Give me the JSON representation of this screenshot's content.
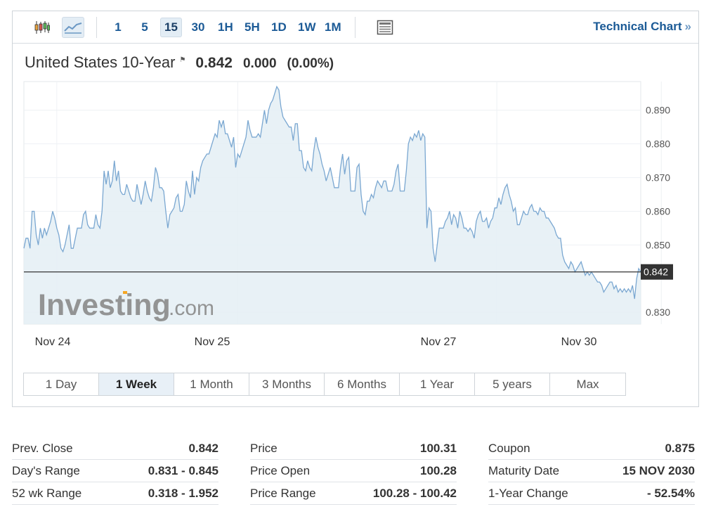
{
  "toolbar": {
    "timeframes": [
      "1",
      "5",
      "15",
      "30",
      "1H",
      "5H",
      "1D",
      "1W",
      "1M"
    ],
    "active_timeframe": "15",
    "technical_chart_label": "Technical Chart",
    "technical_chart_arrow": "»"
  },
  "quote": {
    "name": "United States 10-Year",
    "price": "0.842",
    "change": "0.000",
    "change_pct": "(0.00%)"
  },
  "chart_data": {
    "type": "area",
    "title": "",
    "xlabel": "",
    "ylabel": "",
    "x_tick_labels": [
      "Nov 24",
      "Nov 25",
      "Nov 27",
      "Nov 30"
    ],
    "y_tick_labels": [
      "0.890",
      "0.880",
      "0.870",
      "0.860",
      "0.850",
      "0.830"
    ],
    "ylim": [
      0.8265,
      0.8985
    ],
    "last_value_label": "0.842",
    "last_value": 0.842,
    "watermark": "Investing.com",
    "colors": {
      "line": "#7aa7d1",
      "fill": "#e4eef4",
      "reference": "#333333",
      "badge": "#333333"
    },
    "series": [
      {
        "values": [
          0.849,
          0.852,
          0.852,
          0.849,
          0.86,
          0.86,
          0.853,
          0.85,
          0.855,
          0.852,
          0.855,
          0.853,
          0.855,
          0.857,
          0.86,
          0.858,
          0.855,
          0.853,
          0.849,
          0.848,
          0.85,
          0.853,
          0.856,
          0.849,
          0.849,
          0.852,
          0.855,
          0.855,
          0.855,
          0.859,
          0.86,
          0.856,
          0.855,
          0.855,
          0.855,
          0.859,
          0.856,
          0.855,
          0.86,
          0.872,
          0.868,
          0.872,
          0.867,
          0.869,
          0.875,
          0.869,
          0.872,
          0.866,
          0.865,
          0.865,
          0.868,
          0.866,
          0.864,
          0.863,
          0.863,
          0.868,
          0.865,
          0.862,
          0.865,
          0.869,
          0.866,
          0.864,
          0.863,
          0.867,
          0.873,
          0.871,
          0.867,
          0.867,
          0.866,
          0.86,
          0.855,
          0.859,
          0.86,
          0.861,
          0.864,
          0.865,
          0.86,
          0.86,
          0.862,
          0.869,
          0.866,
          0.864,
          0.872,
          0.865,
          0.87,
          0.869,
          0.873,
          0.875,
          0.876,
          0.877,
          0.877,
          0.879,
          0.881,
          0.883,
          0.882,
          0.887,
          0.885,
          0.887,
          0.883,
          0.883,
          0.881,
          0.879,
          0.882,
          0.873,
          0.877,
          0.876,
          0.878,
          0.88,
          0.882,
          0.887,
          0.884,
          0.882,
          0.882,
          0.882,
          0.883,
          0.882,
          0.886,
          0.89,
          0.886,
          0.89,
          0.892,
          0.893,
          0.895,
          0.897,
          0.896,
          0.891,
          0.888,
          0.887,
          0.886,
          0.885,
          0.885,
          0.881,
          0.886,
          0.886,
          0.878,
          0.878,
          0.873,
          0.872,
          0.875,
          0.873,
          0.872,
          0.878,
          0.882,
          0.879,
          0.877,
          0.874,
          0.872,
          0.869,
          0.871,
          0.873,
          0.87,
          0.867,
          0.867,
          0.867,
          0.873,
          0.877,
          0.871,
          0.875,
          0.876,
          0.866,
          0.866,
          0.866,
          0.873,
          0.874,
          0.865,
          0.86,
          0.859,
          0.863,
          0.863,
          0.865,
          0.864,
          0.867,
          0.869,
          0.868,
          0.867,
          0.869,
          0.869,
          0.866,
          0.866,
          0.866,
          0.868,
          0.872,
          0.874,
          0.866,
          0.866,
          0.866,
          0.872,
          0.88,
          0.882,
          0.881,
          0.883,
          0.882,
          0.884,
          0.881,
          0.883,
          0.882,
          0.855,
          0.861,
          0.86,
          0.849,
          0.845,
          0.85,
          0.855,
          0.855,
          0.855,
          0.857,
          0.858,
          0.86,
          0.856,
          0.859,
          0.858,
          0.855,
          0.86,
          0.858,
          0.855,
          0.855,
          0.854,
          0.855,
          0.854,
          0.852,
          0.857,
          0.859,
          0.86,
          0.857,
          0.857,
          0.858,
          0.855,
          0.857,
          0.858,
          0.861,
          0.861,
          0.864,
          0.862,
          0.865,
          0.867,
          0.868,
          0.865,
          0.863,
          0.86,
          0.861,
          0.856,
          0.856,
          0.858,
          0.86,
          0.859,
          0.859,
          0.861,
          0.862,
          0.86,
          0.86,
          0.859,
          0.861,
          0.86,
          0.86,
          0.858,
          0.858,
          0.857,
          0.856,
          0.855,
          0.853,
          0.852,
          0.852,
          0.847,
          0.845,
          0.844,
          0.843,
          0.845,
          0.844,
          0.842,
          0.843,
          0.844,
          0.845,
          0.843,
          0.841,
          0.842,
          0.841,
          0.842,
          0.841,
          0.84,
          0.839,
          0.839,
          0.838,
          0.836,
          0.837,
          0.838,
          0.839,
          0.839,
          0.837,
          0.838,
          0.836,
          0.837,
          0.836,
          0.837,
          0.836,
          0.837,
          0.836,
          0.838,
          0.834,
          0.84,
          0.843,
          0.842
        ]
      }
    ]
  },
  "time_ranges": [
    "1 Day",
    "1 Week",
    "1 Month",
    "3 Months",
    "6 Months",
    "1 Year",
    "5 years",
    "Max"
  ],
  "active_range": "1 Week",
  "stats": {
    "col1": [
      {
        "label": "Prev. Close",
        "value": "0.842"
      },
      {
        "label": "Day's Range",
        "value": "0.831 - 0.845"
      },
      {
        "label": "52 wk Range",
        "value": "0.318 - 1.952"
      }
    ],
    "col2": [
      {
        "label": "Price",
        "value": "100.31"
      },
      {
        "label": "Price Open",
        "value": "100.28"
      },
      {
        "label": "Price Range",
        "value": "100.28 - 100.42"
      }
    ],
    "col3": [
      {
        "label": "Coupon",
        "value": "0.875"
      },
      {
        "label": "Maturity Date",
        "value": "15 NOV 2030"
      },
      {
        "label": "1-Year Change",
        "value": "- 52.54%"
      }
    ]
  }
}
